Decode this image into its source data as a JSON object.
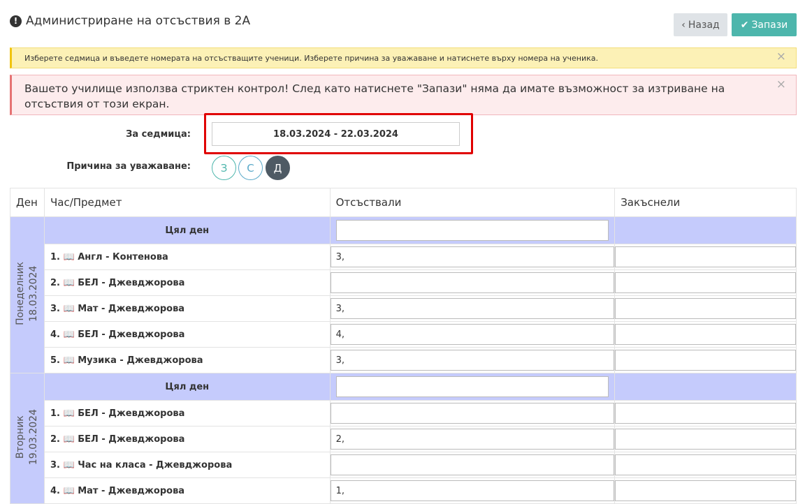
{
  "header": {
    "title": "Администриране на отсъствия в 2А",
    "back_label": "Назад",
    "save_label": "Запази"
  },
  "alerts": {
    "info": "Изберете седмица и въведете номерата на отсъстващите ученици. Изберете причина за уважаване и натиснете върху номера на ученика.",
    "danger": "Вашето училище използва стриктен контрол! След като натиснете \"Запази\" няма да имате възможност за изтриване на отсъствия от този екран.",
    "close": "×"
  },
  "form": {
    "week_label": "За седмица:",
    "week_value": "18.03.2024 - 22.03.2024",
    "reason_label": "Причина за уважаване:",
    "reasons": [
      "З",
      "С",
      "Д"
    ]
  },
  "table": {
    "headers": [
      "Ден",
      "Час/Предмет",
      "Отсъствали",
      "Закъснели"
    ],
    "whole_day_label": "Цял ден",
    "days": [
      {
        "name": "Понеделник",
        "date": "18.03.2024",
        "lessons": [
          {
            "num": "1.",
            "subject": "Англ - Контенова",
            "absent": "3,",
            "late": ""
          },
          {
            "num": "2.",
            "subject": "БЕЛ - Джевджорова",
            "absent": "",
            "late": ""
          },
          {
            "num": "3.",
            "subject": "Мат - Джевджорова",
            "absent": "3,",
            "late": ""
          },
          {
            "num": "4.",
            "subject": "БЕЛ - Джевджорова",
            "absent": "4,",
            "late": ""
          },
          {
            "num": "5.",
            "subject": "Музика - Джевджорова",
            "absent": "3,",
            "late": ""
          }
        ]
      },
      {
        "name": "Вторник",
        "date": "19.03.2024",
        "lessons": [
          {
            "num": "1.",
            "subject": "БЕЛ - Джевджорова",
            "absent": "",
            "late": ""
          },
          {
            "num": "2.",
            "subject": "БЕЛ - Джевджорова",
            "absent": "2,",
            "late": ""
          },
          {
            "num": "3.",
            "subject": "Час на класа - Джевджорова",
            "absent": "",
            "late": ""
          },
          {
            "num": "4.",
            "subject": "Мат - Джевджорова",
            "absent": "1,",
            "late": ""
          }
        ]
      }
    ]
  },
  "icons": {
    "info": "exclamation-circle-icon",
    "back": "chevron-left-icon",
    "save": "check-icon",
    "subject": "book-icon"
  },
  "colors": {
    "save_button": "#4db6ac",
    "day_background": "#c5cbfc",
    "highlight": "#e00000"
  }
}
